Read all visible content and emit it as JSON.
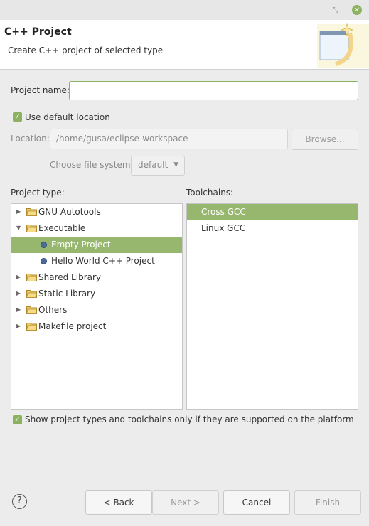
{
  "window": {
    "restore_glyph": "⤡",
    "close_glyph": "✕"
  },
  "banner": {
    "title": "C++ Project",
    "description": "Create C++ project of selected type"
  },
  "form": {
    "project_name_label": "Project name:",
    "project_name_value": "",
    "use_default_location_label": "Use default location",
    "use_default_location_checked": true,
    "location_label": "Location:",
    "location_value": "/home/gusa/eclipse-workspace",
    "browse_label": "Browse...",
    "file_system_label": "Choose file system:",
    "file_system_value": "default"
  },
  "project_type": {
    "header": "Project type:",
    "items": [
      {
        "label": "GNU Autotools",
        "kind": "folder",
        "expanded": false,
        "level": 0,
        "selected": false
      },
      {
        "label": "Executable",
        "kind": "folder",
        "expanded": true,
        "level": 0,
        "selected": false
      },
      {
        "label": "Empty Project",
        "kind": "project",
        "level": 1,
        "selected": true
      },
      {
        "label": "Hello World C++ Project",
        "kind": "project",
        "level": 1,
        "selected": false
      },
      {
        "label": "Shared Library",
        "kind": "folder",
        "expanded": false,
        "level": 0,
        "selected": false
      },
      {
        "label": "Static Library",
        "kind": "folder",
        "expanded": false,
        "level": 0,
        "selected": false
      },
      {
        "label": "Others",
        "kind": "folder",
        "expanded": false,
        "level": 0,
        "selected": false
      },
      {
        "label": "Makefile project",
        "kind": "folder",
        "expanded": false,
        "level": 0,
        "selected": false
      }
    ]
  },
  "toolchains": {
    "header": "Toolchains:",
    "items": [
      {
        "label": "Cross GCC",
        "selected": true
      },
      {
        "label": "Linux GCC",
        "selected": false
      }
    ]
  },
  "filter": {
    "label": "Show project types and toolchains only if they are supported on the platform",
    "checked": true
  },
  "buttons": {
    "help": "?",
    "back": "< Back",
    "next": "Next >",
    "cancel": "Cancel",
    "finish": "Finish"
  },
  "colors": {
    "accent": "#8cb160",
    "selection": "#97b76e"
  },
  "icons": {
    "checkbox_check": "✓",
    "collapsed": "▶",
    "expanded": "▼",
    "dropdown": "▼"
  }
}
